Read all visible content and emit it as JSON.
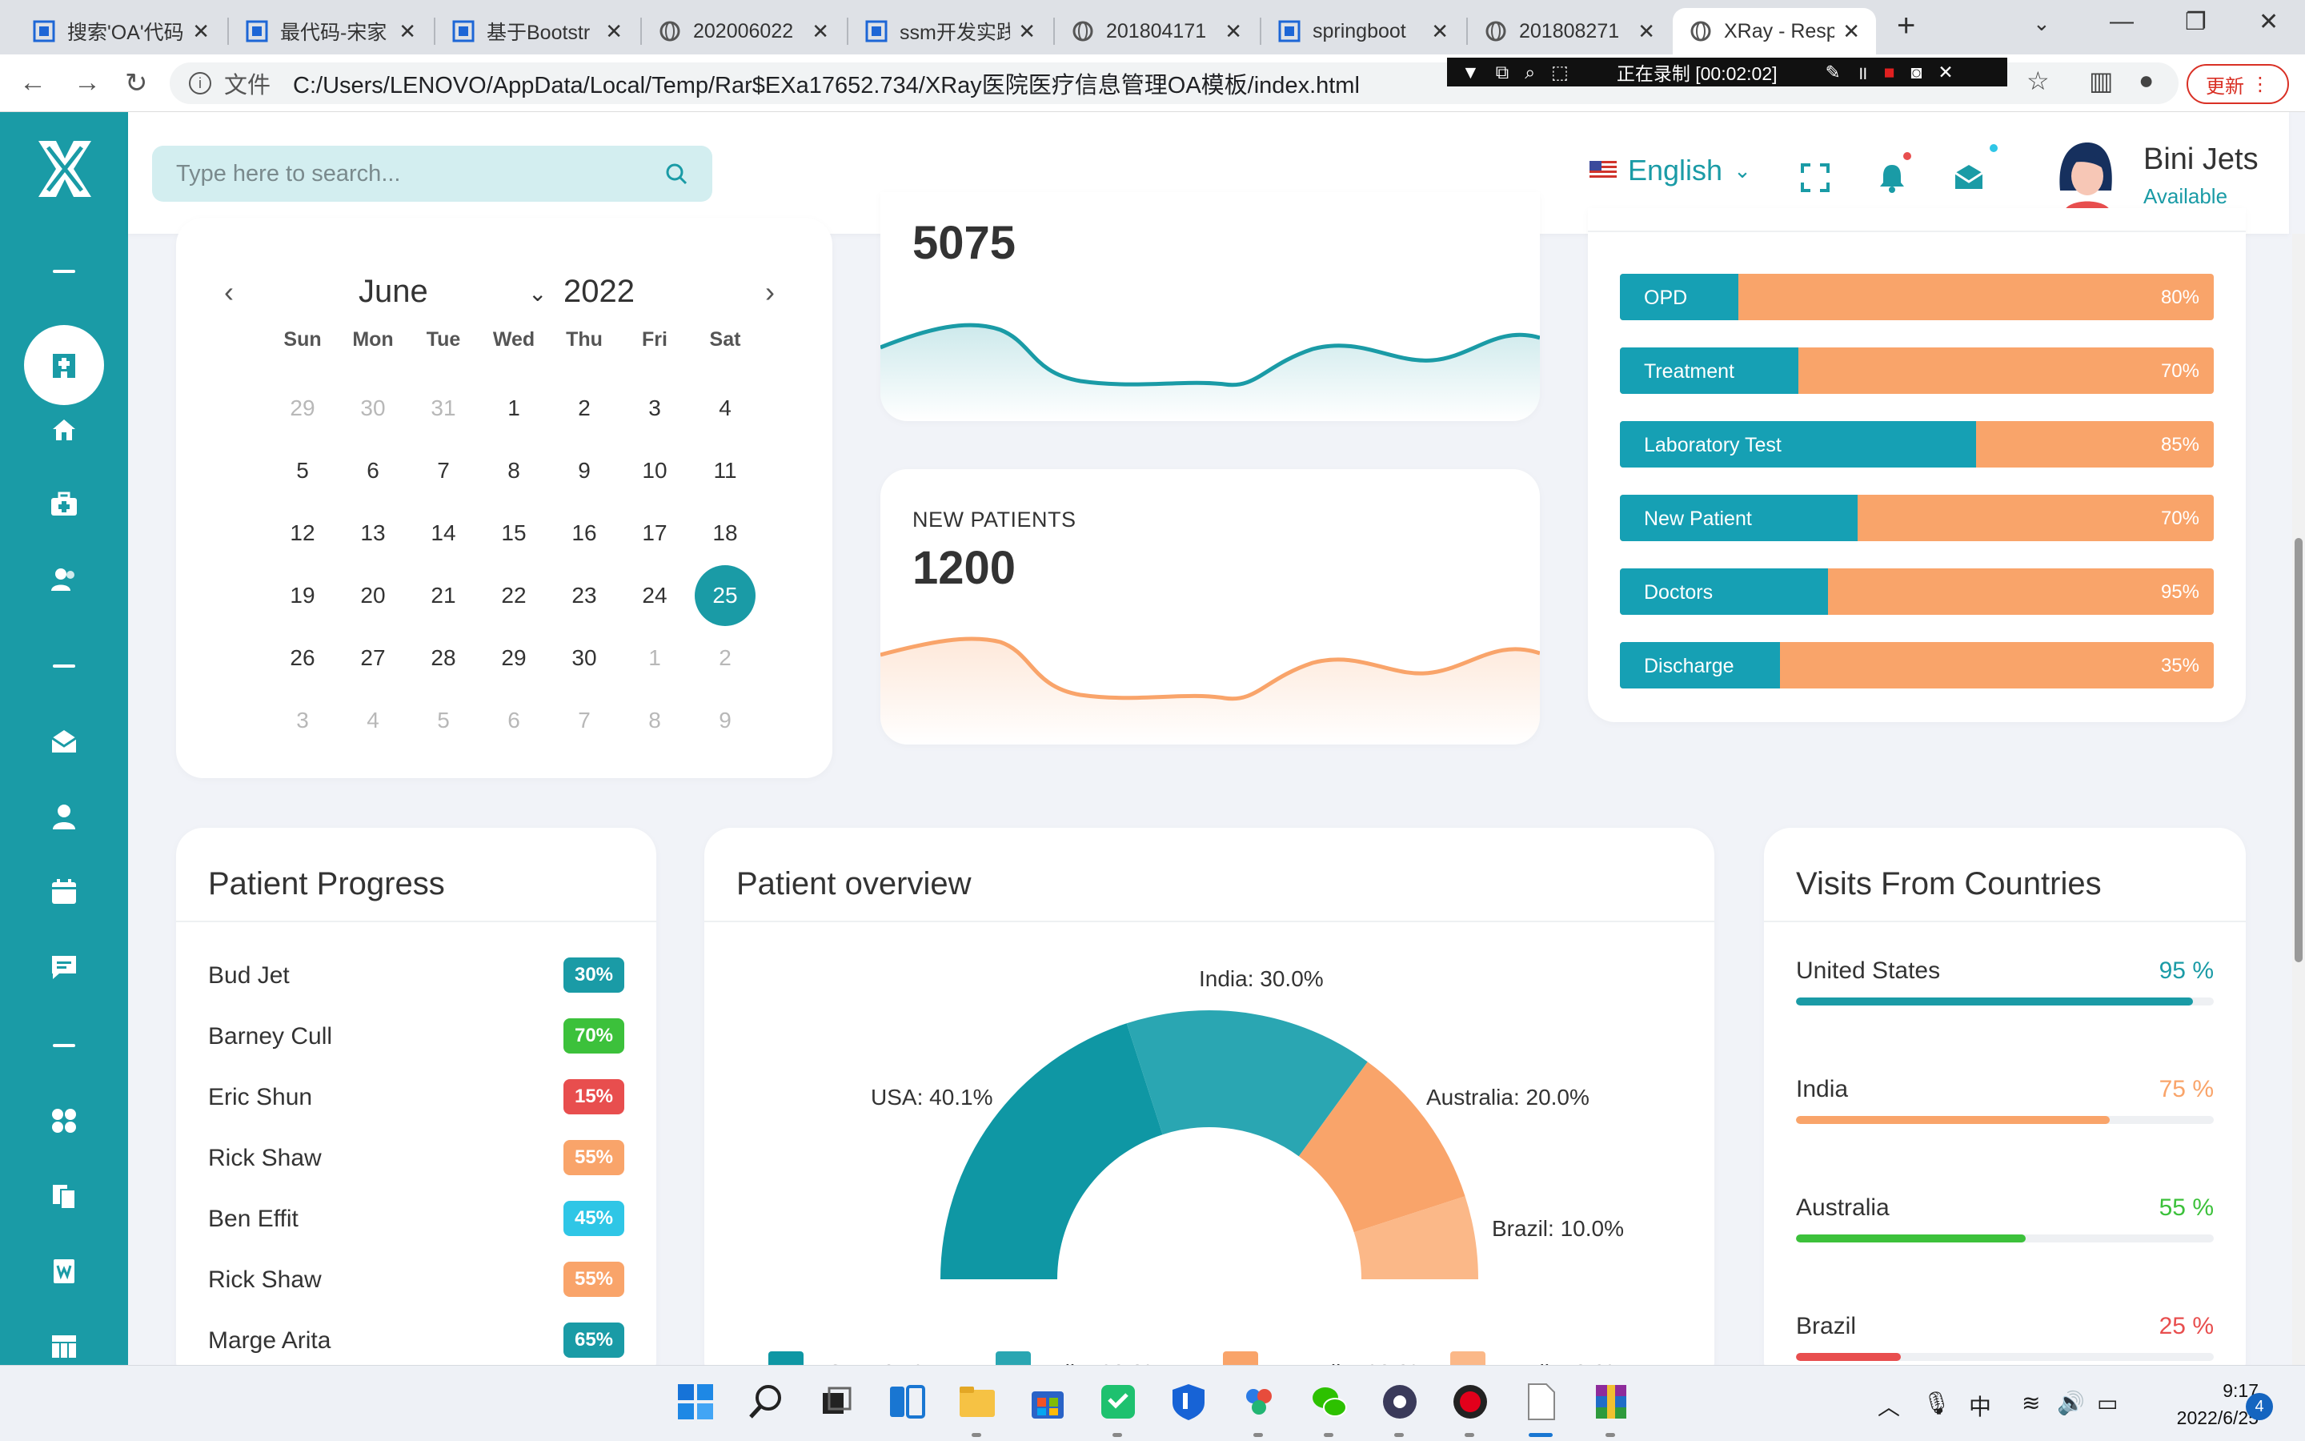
{
  "browser": {
    "tabs": [
      {
        "title": "搜索'OA'代码"
      },
      {
        "title": "最代码-宋家"
      },
      {
        "title": "基于Bootstr"
      },
      {
        "title": "202006022"
      },
      {
        "title": "ssm开发实践"
      },
      {
        "title": "201804171"
      },
      {
        "title": "springboot"
      },
      {
        "title": "201808271"
      },
      {
        "title": "XRay - Resp"
      }
    ],
    "address_label": "文件",
    "url": "C:/Users/LENOVO/AppData/Local/Temp/Rar$EXa17652.734/XRay医院医疗信息管理OA模板/index.html",
    "recording_text": "正在录制 [00:02:02]",
    "update_label": "更新"
  },
  "header": {
    "search_placeholder": "Type here to search...",
    "language": "English",
    "user_name": "Bini Jets",
    "user_status": "Available"
  },
  "calendar": {
    "month": "June",
    "year": "2022",
    "weekdays": [
      "Sun",
      "Mon",
      "Tue",
      "Wed",
      "Thu",
      "Fri",
      "Sat"
    ],
    "days": [
      [
        "29",
        "30",
        "31",
        "1",
        "2",
        "3",
        "4"
      ],
      [
        "5",
        "6",
        "7",
        "8",
        "9",
        "10",
        "11"
      ],
      [
        "12",
        "13",
        "14",
        "15",
        "16",
        "17",
        "18"
      ],
      [
        "19",
        "20",
        "21",
        "22",
        "23",
        "24",
        "25"
      ],
      [
        "26",
        "27",
        "28",
        "29",
        "30",
        "1",
        "2"
      ],
      [
        "3",
        "4",
        "5",
        "6",
        "7",
        "8",
        "9"
      ]
    ],
    "selected": "25"
  },
  "stats": {
    "top_value": "5075",
    "new_patients_label": "NEW PATIENTS",
    "new_patients_value": "1200"
  },
  "departments": [
    {
      "name": "OPD",
      "percent": 80,
      "label": "80%"
    },
    {
      "name": "Treatment",
      "percent": 70,
      "label": "70%"
    },
    {
      "name": "Laboratory Test",
      "percent": 85,
      "label": "85%"
    },
    {
      "name": "New Patient",
      "percent": 70,
      "label": "70%"
    },
    {
      "name": "Doctors",
      "percent": 95,
      "label": "95%"
    },
    {
      "name": "Discharge",
      "percent": 35,
      "label": "35%"
    }
  ],
  "patient_progress": {
    "title": "Patient Progress",
    "rows": [
      {
        "name": "Bud Jet",
        "value": "30%",
        "color": "#1a9ba6"
      },
      {
        "name": "Barney Cull",
        "value": "70%",
        "color": "#3cc13b"
      },
      {
        "name": "Eric Shun",
        "value": "15%",
        "color": "#e84e4e"
      },
      {
        "name": "Rick Shaw",
        "value": "55%",
        "color": "#f9a46a"
      },
      {
        "name": "Ben Effit",
        "value": "45%",
        "color": "#2fc6e6"
      },
      {
        "name": "Rick Shaw",
        "value": "55%",
        "color": "#f9a46a"
      },
      {
        "name": "Marge Arita",
        "value": "65%",
        "color": "#1a9ba6"
      }
    ]
  },
  "patient_overview": {
    "title": "Patient overview",
    "chart_data": {
      "type": "pie",
      "categories": [
        "USA",
        "India",
        "Australia",
        "Brazil"
      ],
      "values": [
        40.1,
        30.0,
        20.0,
        10.0
      ],
      "labels": [
        "USA: 40.1%",
        "India: 30.0%",
        "Australia: 20.0%",
        "Brazil: 10.0%"
      ],
      "colors": [
        "#0f97a4",
        "#2aa6b2",
        "#f9a46a",
        "#fbb888"
      ],
      "legend": "bottom"
    }
  },
  "visits": {
    "title": "Visits From Countries",
    "rows": [
      {
        "country": "United States",
        "value": 95,
        "label": "95 %",
        "color": "#1a9ba6"
      },
      {
        "country": "India",
        "value": 75,
        "label": "75 %",
        "color": "#f9a46a"
      },
      {
        "country": "Australia",
        "value": 55,
        "label": "55 %",
        "color": "#3cc13b"
      },
      {
        "country": "Brazil",
        "value": 25,
        "label": "25 %",
        "color": "#e84e4e"
      }
    ]
  },
  "taskbar": {
    "time": "9:17",
    "date": "2022/6/25",
    "ime": "中",
    "notifications": "4"
  },
  "colors": {
    "primary": "#1a9ba6",
    "accent": "#f9a46a",
    "bar_teal": "#16a0b4"
  }
}
